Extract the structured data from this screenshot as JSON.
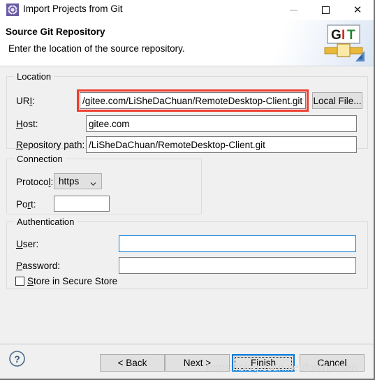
{
  "window": {
    "title": "Import Projects from Git",
    "app_icon": "gear-icon",
    "controls": {
      "minimize": "minimize-icon",
      "maximize": "maximize-icon",
      "close": "close-icon"
    }
  },
  "header": {
    "title": "Source Git Repository",
    "description": "Enter the location of the source repository.",
    "logo_g": "G",
    "logo_i": "I",
    "logo_t": "T"
  },
  "location": {
    "legend": "Location",
    "uri_label": "URI:",
    "uri_value": "/gitee.com/LiSheDaChuan/RemoteDesktop-Client.git",
    "uri_placeholder": "",
    "local_file_button": "Local File...",
    "host_label": "Host:",
    "host_value": "gitee.com",
    "host_placeholder": "",
    "repo_label": "Repository path:",
    "repo_value": "/LiSheDaChuan/RemoteDesktop-Client.git",
    "repo_placeholder": ""
  },
  "connection": {
    "legend": "Connection",
    "protocol_label": "Protocol:",
    "protocol_value": "https",
    "port_label": "Port:",
    "port_value": "",
    "port_placeholder": ""
  },
  "authentication": {
    "legend": "Authentication",
    "user_label": "User:",
    "user_value": "",
    "user_placeholder": "",
    "password_label": "Password:",
    "password_value": "",
    "password_placeholder": "",
    "store_secure_label": "Store in Secure Store",
    "store_secure_checked": false
  },
  "buttons": {
    "help": "help-icon",
    "back": "< Back",
    "next": "Next >",
    "finish": "Finish",
    "cancel": "Cancel"
  },
  "watermark": "https://blog.csdn.net/forchoosen",
  "colors": {
    "accent": "#0078d7",
    "highlight_rect": "#f03e31",
    "dialog_bg": "#f0f0f0",
    "button_bg": "#e1e1e1"
  }
}
